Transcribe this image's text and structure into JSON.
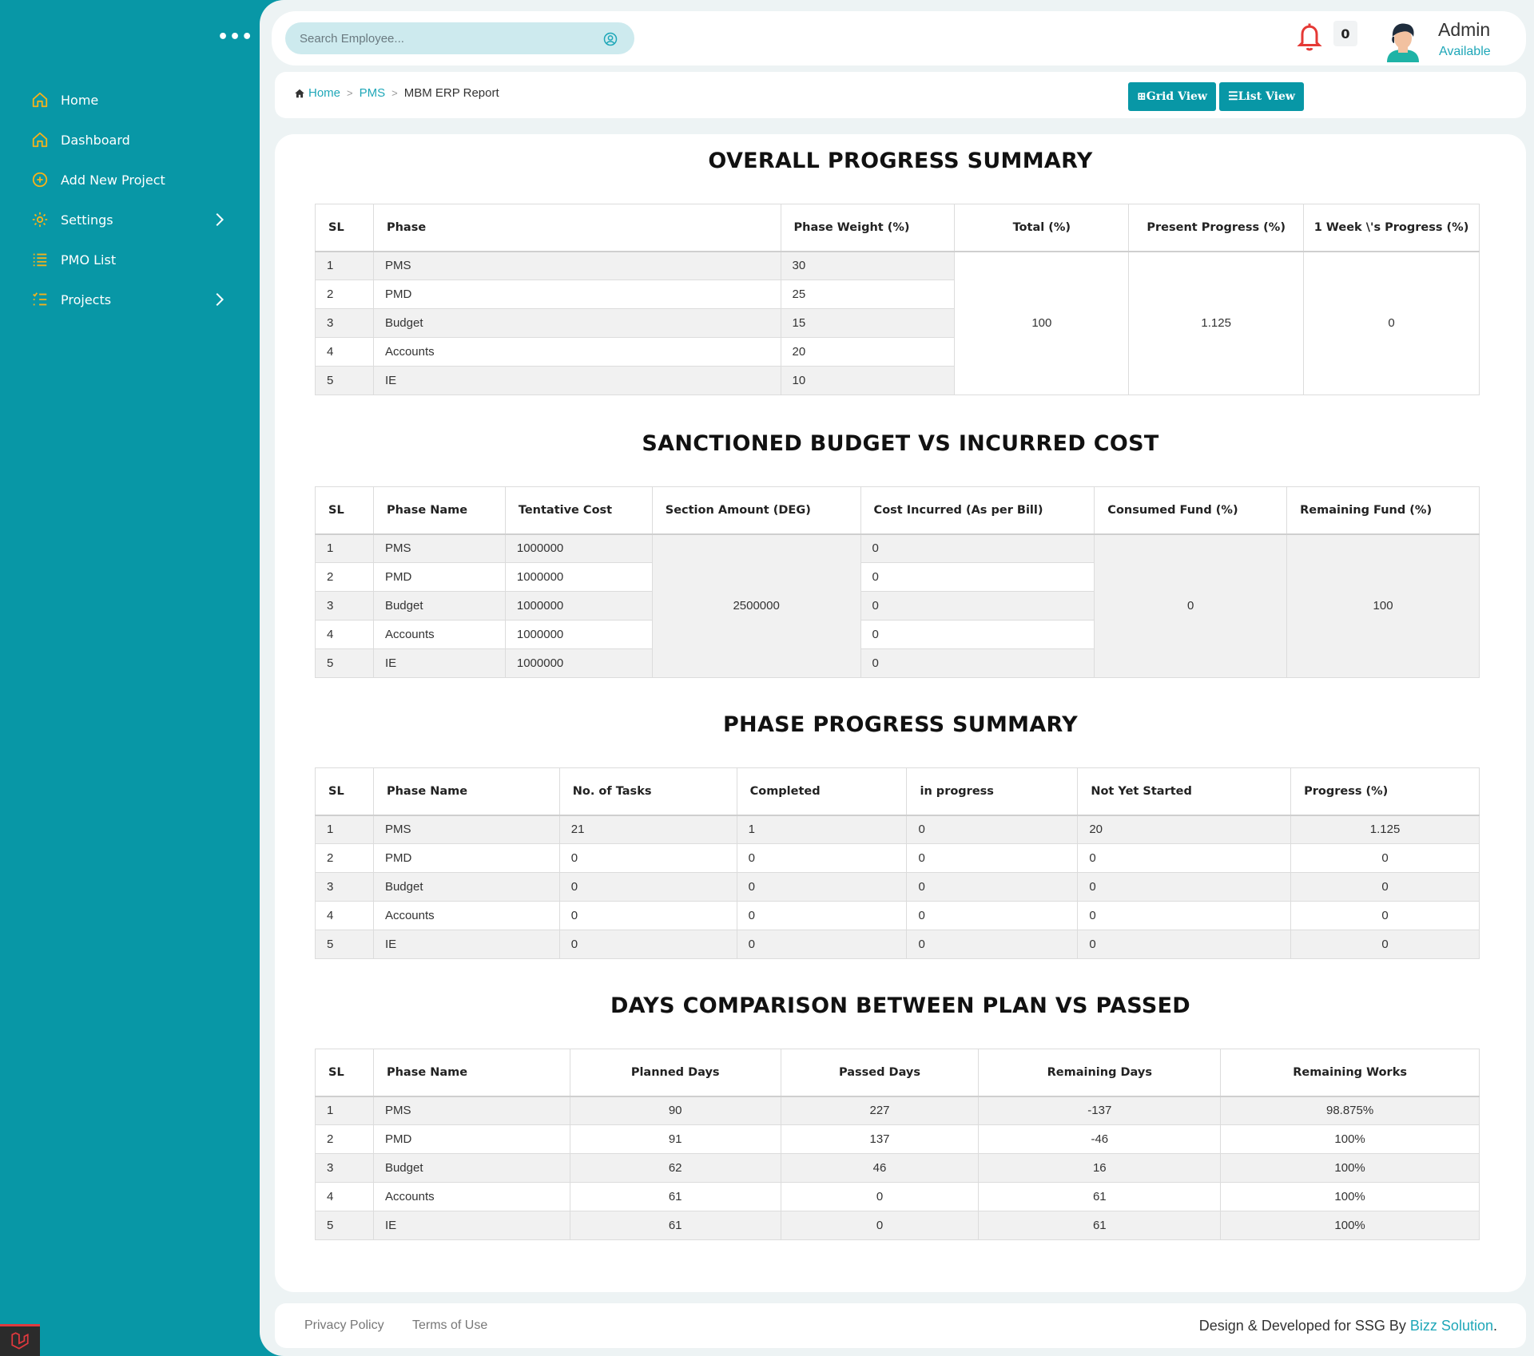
{
  "sidebar": {
    "menu_dots": "•••",
    "items": [
      {
        "label": "Home",
        "icon": "home-icon",
        "has_children": false
      },
      {
        "label": "Dashboard",
        "icon": "home-icon",
        "has_children": false
      },
      {
        "label": "Add New Project",
        "icon": "plus-circle-icon",
        "has_children": false
      },
      {
        "label": "Settings",
        "icon": "gear-icon",
        "has_children": true
      },
      {
        "label": "PMO List",
        "icon": "list-icon",
        "has_children": false
      },
      {
        "label": "Projects",
        "icon": "tasks-icon",
        "has_children": true
      }
    ]
  },
  "topbar": {
    "search_placeholder": "Search Employee...",
    "notification_count": "0",
    "user_name": "Admin",
    "user_status": "Available"
  },
  "breadcrumb": {
    "home": "Home",
    "parent": "PMS",
    "current": "MBM ERP Report"
  },
  "buttons": {
    "grid_view": "⊞Grid View",
    "list_view": "☰List View"
  },
  "colors": {
    "primary": "#0897a6",
    "accent_icon": "#f5b21b",
    "link": "#1fa7b8",
    "bell": "#e53935"
  },
  "overall": {
    "title": "OVERALL PROGRESS SUMMARY",
    "headers": [
      "SL",
      "Phase",
      "Phase Weight (%)",
      "Total (%)",
      "Present Progress (%)",
      "1 Week \\'s Progress (%)"
    ],
    "rows": [
      {
        "sl": "1",
        "phase": "PMS",
        "weight": "30"
      },
      {
        "sl": "2",
        "phase": "PMD",
        "weight": "25"
      },
      {
        "sl": "3",
        "phase": "Budget",
        "weight": "15"
      },
      {
        "sl": "4",
        "phase": "Accounts",
        "weight": "20"
      },
      {
        "sl": "5",
        "phase": "IE",
        "weight": "10"
      }
    ],
    "total": "100",
    "present_progress": "1.125",
    "week_progress": "0"
  },
  "budget": {
    "title": "SANCTIONED BUDGET VS INCURRED COST",
    "headers": [
      "SL",
      "Phase Name",
      "Tentative Cost",
      "Section Amount (DEG)",
      "Cost Incurred (As per Bill)",
      "Consumed Fund (%)",
      "Remaining Fund (%)"
    ],
    "rows": [
      {
        "sl": "1",
        "phase": "PMS",
        "tentative": "1000000",
        "incurred": "0"
      },
      {
        "sl": "2",
        "phase": "PMD",
        "tentative": "1000000",
        "incurred": "0"
      },
      {
        "sl": "3",
        "phase": "Budget",
        "tentative": "1000000",
        "incurred": "0"
      },
      {
        "sl": "4",
        "phase": "Accounts",
        "tentative": "1000000",
        "incurred": "0"
      },
      {
        "sl": "5",
        "phase": "IE",
        "tentative": "1000000",
        "incurred": "0"
      }
    ],
    "section_amount": "2500000",
    "consumed": "0",
    "remaining": "100"
  },
  "phase_progress": {
    "title": "PHASE PROGRESS SUMMARY",
    "headers": [
      "SL",
      "Phase Name",
      "No. of Tasks",
      "Completed",
      "in progress",
      "Not Yet Started",
      "Progress (%)"
    ],
    "rows": [
      [
        "1",
        "PMS",
        "21",
        "1",
        "0",
        "20",
        "1.125"
      ],
      [
        "2",
        "PMD",
        "0",
        "0",
        "0",
        "0",
        "0"
      ],
      [
        "3",
        "Budget",
        "0",
        "0",
        "0",
        "0",
        "0"
      ],
      [
        "4",
        "Accounts",
        "0",
        "0",
        "0",
        "0",
        "0"
      ],
      [
        "5",
        "IE",
        "0",
        "0",
        "0",
        "0",
        "0"
      ]
    ]
  },
  "days": {
    "title": "DAYS COMPARISON BETWEEN PLAN VS PASSED",
    "headers": [
      "SL",
      "Phase Name",
      "Planned Days",
      "Passed Days",
      "Remaining Days",
      "Remaining Works"
    ],
    "rows": [
      [
        "1",
        "PMS",
        "90",
        "227",
        "-137",
        "98.875%"
      ],
      [
        "2",
        "PMD",
        "91",
        "137",
        "-46",
        "100%"
      ],
      [
        "3",
        "Budget",
        "62",
        "46",
        "16",
        "100%"
      ],
      [
        "4",
        "Accounts",
        "61",
        "0",
        "61",
        "100%"
      ],
      [
        "5",
        "IE",
        "61",
        "0",
        "61",
        "100%"
      ]
    ]
  },
  "footer": {
    "privacy": "Privacy Policy",
    "terms": "Terms of Use",
    "credit_prefix": "Design & Developed for SSG By ",
    "credit_brand": "Bizz Solution",
    "credit_suffix": "."
  }
}
